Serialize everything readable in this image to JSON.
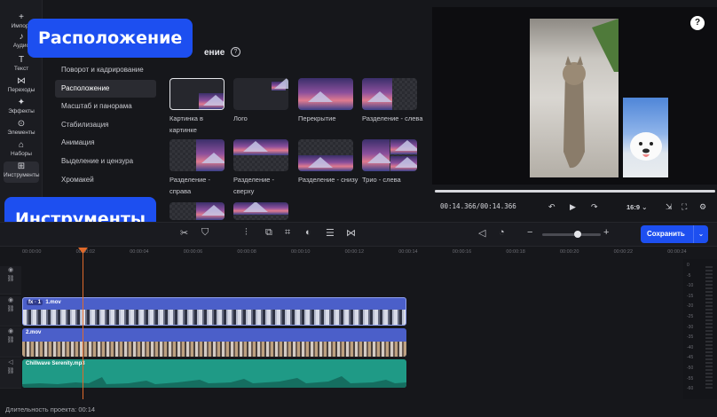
{
  "rail": {
    "items": [
      {
        "label": "Импорт",
        "icon": "plus"
      },
      {
        "label": "Аудио",
        "icon": "music"
      },
      {
        "label": "Текст",
        "icon": "text"
      },
      {
        "label": "Переходы",
        "icon": "transition"
      },
      {
        "label": "Эффекты",
        "icon": "sparkle"
      },
      {
        "label": "Элементы",
        "icon": "elements"
      },
      {
        "label": "Наборы",
        "icon": "bag"
      },
      {
        "label": "Инструменты",
        "icon": "tools"
      }
    ]
  },
  "menu": {
    "items": [
      {
        "label": "Поворот и кадрирование"
      },
      {
        "label": "Расположение"
      },
      {
        "label": "Масштаб и панорама"
      },
      {
        "label": "Стабилизация"
      },
      {
        "label": "Анимация"
      },
      {
        "label": "Выделение и цензура"
      },
      {
        "label": "Хромакей"
      }
    ]
  },
  "layouts": {
    "title": "ение",
    "help_icon": "question-circle-icon",
    "items": [
      {
        "label": "Картинка в картинке"
      },
      {
        "label": "Лого"
      },
      {
        "label": "Перекрытие"
      },
      {
        "label": "Разделение - слева"
      },
      {
        "label": "Разделение - справа"
      },
      {
        "label": "Разделение - сверху"
      },
      {
        "label": "Разделение - снизу"
      },
      {
        "label": "Трио - слева"
      }
    ]
  },
  "callouts": {
    "top": "Расположение",
    "bottom": "Инструменты"
  },
  "player": {
    "timecode": "00:14.366/00:14.366",
    "aspect": "16:9",
    "progress": 1.0
  },
  "toolbar": {
    "save_label": "Сохранить",
    "zoom_level": 0.6
  },
  "ruler": {
    "ticks": [
      "00:00:00",
      "00:00:02",
      "00:00:04",
      "00:00:06",
      "00:00:08",
      "00:00:10",
      "00:00:12",
      "00:00:14",
      "00:00:16",
      "00:00:18",
      "00:00:20",
      "00:00:22",
      "00:00:24"
    ]
  },
  "tracks": {
    "clip1": {
      "badge": "fx · 1",
      "name": "1.mov"
    },
    "clip2": {
      "name": "2.mov"
    },
    "audio": {
      "name": "Chillwave Serenity.mp3"
    }
  },
  "meter": {
    "labels": [
      "0",
      "-5",
      "-10",
      "-15",
      "-20",
      "-25",
      "-30",
      "-35",
      "-40",
      "-45",
      "-50",
      "-55",
      "-60"
    ]
  },
  "status": {
    "duration": "Длительность проекта: 00:14"
  },
  "colors": {
    "accent": "#1d4ff0",
    "clip_video": "#4b5fc9",
    "clip_audio": "#1f9a86",
    "playhead": "#e06a2b"
  }
}
